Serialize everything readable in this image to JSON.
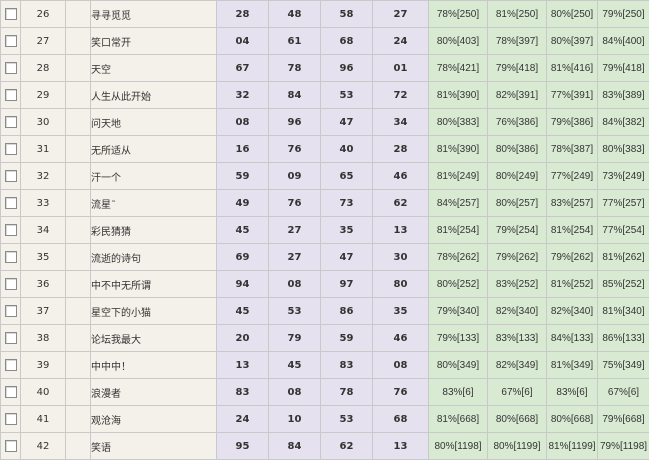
{
  "rows": [
    {
      "id": "26",
      "name": "寻寻觅觅",
      "picks": [
        "28",
        "48",
        "58",
        "27"
      ],
      "rates": [
        "78%[250]",
        "81%[250]",
        "80%[250]",
        "79%[250]"
      ]
    },
    {
      "id": "27",
      "name": "笑口常开",
      "picks": [
        "04",
        "61",
        "68",
        "24"
      ],
      "rates": [
        "80%[403]",
        "78%[397]",
        "80%[397]",
        "84%[400]"
      ]
    },
    {
      "id": "28",
      "name": "天空",
      "picks": [
        "67",
        "78",
        "96",
        "01"
      ],
      "rates": [
        "78%[421]",
        "79%[418]",
        "81%[416]",
        "79%[418]"
      ]
    },
    {
      "id": "29",
      "name": "人生从此开始",
      "picks": [
        "32",
        "84",
        "53",
        "72"
      ],
      "rates": [
        "81%[390]",
        "82%[391]",
        "77%[391]",
        "83%[389]"
      ]
    },
    {
      "id": "30",
      "name": "问天地",
      "picks": [
        "08",
        "96",
        "47",
        "34"
      ],
      "rates": [
        "80%[383]",
        "76%[386]",
        "79%[386]",
        "84%[382]"
      ]
    },
    {
      "id": "31",
      "name": "无所适从",
      "picks": [
        "16",
        "76",
        "40",
        "28"
      ],
      "rates": [
        "81%[390]",
        "80%[386]",
        "78%[387]",
        "80%[383]"
      ]
    },
    {
      "id": "32",
      "name": "汗一个",
      "picks": [
        "59",
        "09",
        "65",
        "46"
      ],
      "rates": [
        "81%[249]",
        "80%[249]",
        "77%[249]",
        "73%[249]"
      ]
    },
    {
      "id": "33",
      "name": "流星˜",
      "picks": [
        "49",
        "76",
        "73",
        "62"
      ],
      "rates": [
        "84%[257]",
        "80%[257]",
        "83%[257]",
        "77%[257]"
      ]
    },
    {
      "id": "34",
      "name": "彩民猜猜",
      "picks": [
        "45",
        "27",
        "35",
        "13"
      ],
      "rates": [
        "81%[254]",
        "79%[254]",
        "81%[254]",
        "77%[254]"
      ]
    },
    {
      "id": "35",
      "name": "流逝的诗句",
      "picks": [
        "69",
        "27",
        "47",
        "30"
      ],
      "rates": [
        "78%[262]",
        "79%[262]",
        "79%[262]",
        "81%[262]"
      ]
    },
    {
      "id": "36",
      "name": "中不中无所谓",
      "picks": [
        "94",
        "08",
        "97",
        "80"
      ],
      "rates": [
        "80%[252]",
        "83%[252]",
        "81%[252]",
        "85%[252]"
      ]
    },
    {
      "id": "37",
      "name": "星空下的小猫",
      "picks": [
        "45",
        "53",
        "86",
        "35"
      ],
      "rates": [
        "79%[340]",
        "82%[340]",
        "82%[340]",
        "81%[340]"
      ]
    },
    {
      "id": "38",
      "name": "论坛我最大",
      "picks": [
        "20",
        "79",
        "59",
        "46"
      ],
      "rates": [
        "79%[133]",
        "83%[133]",
        "84%[133]",
        "86%[133]"
      ]
    },
    {
      "id": "39",
      "name": "中中中！",
      "picks": [
        "13",
        "45",
        "83",
        "08"
      ],
      "rates": [
        "80%[349]",
        "82%[349]",
        "81%[349]",
        "75%[349]"
      ]
    },
    {
      "id": "40",
      "name": "浪漫者",
      "picks": [
        "83",
        "08",
        "78",
        "76"
      ],
      "rates": [
        "83%[6]",
        "67%[6]",
        "83%[6]",
        "67%[6]"
      ]
    },
    {
      "id": "41",
      "name": "观沧海",
      "picks": [
        "24",
        "10",
        "53",
        "68"
      ],
      "rates": [
        "81%[668]",
        "80%[668]",
        "80%[668]",
        "79%[668]"
      ]
    },
    {
      "id": "42",
      "name": "笑语",
      "picks": [
        "95",
        "84",
        "62",
        "13"
      ],
      "rates": [
        "80%[1198]",
        "80%[1199]",
        "81%[1199]",
        "79%[1198]"
      ]
    }
  ]
}
